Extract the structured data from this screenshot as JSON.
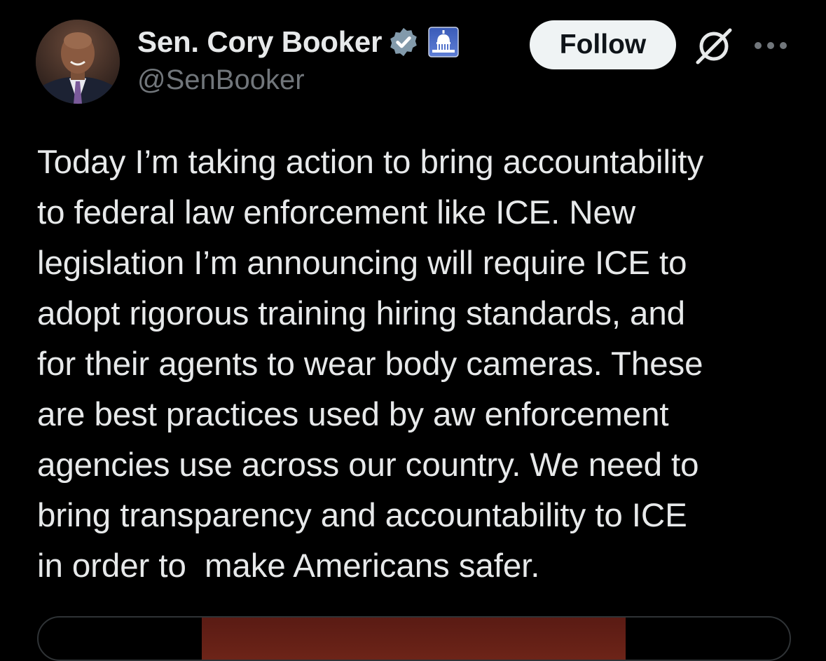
{
  "author": {
    "display_name": "Sen. Cory Booker",
    "handle": "@SenBooker",
    "verified_icon": "verified-badge-icon",
    "affiliation_icon": "us-capitol-icon"
  },
  "actions": {
    "follow_label": "Follow",
    "grok_icon": "grok-icon",
    "more_icon": "more-dots-icon"
  },
  "tweet": {
    "text": "Today I’m taking action to bring accountability\nto federal law enforcement like ICE. New\nlegislation I’m announcing will require ICE to\nadopt rigorous training hiring standards, and\nfor their agents to wear body cameras. These\nare best practices used by aw enforcement\nagencies use across our country. We need to\nbring transparency and accountability to ICE\nin order to  make Americans safer."
  },
  "colors": {
    "background": "#000000",
    "text_primary": "#e7e9ea",
    "text_secondary": "#71767b",
    "follow_bg": "#eff3f4",
    "verified_badge": "#829aab"
  }
}
